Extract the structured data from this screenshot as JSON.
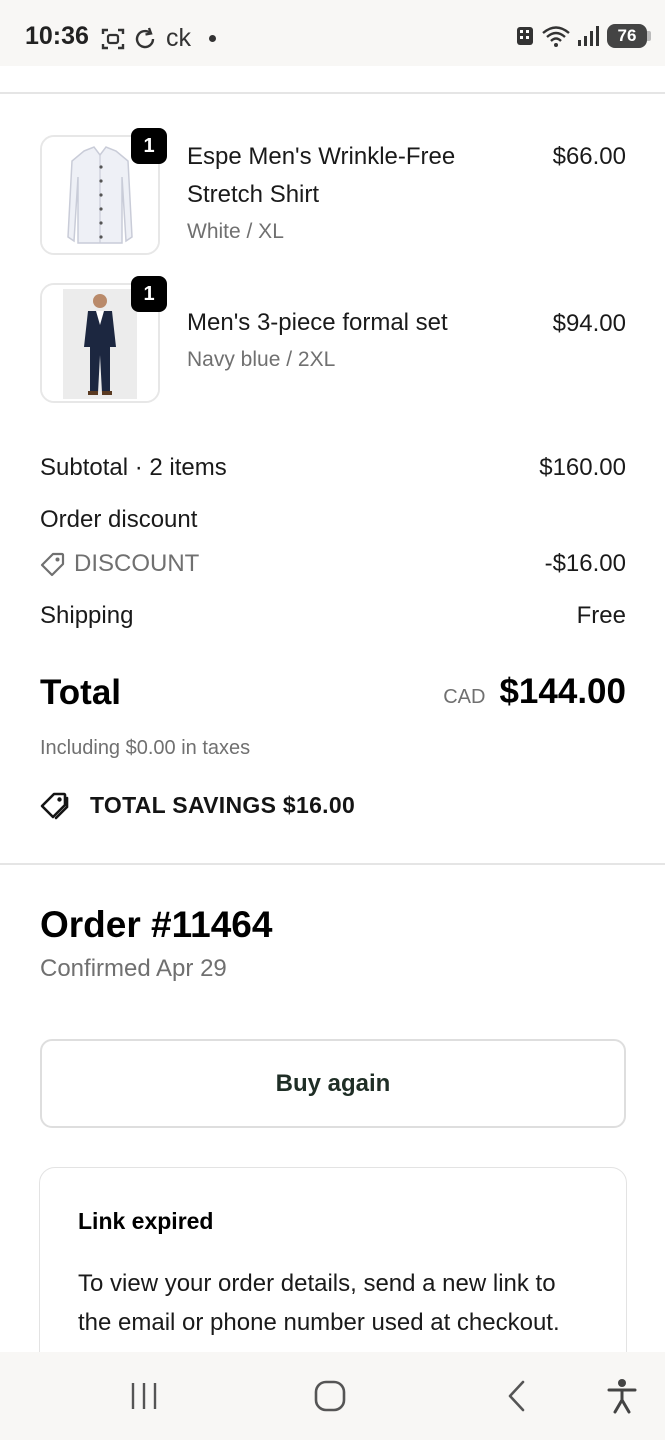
{
  "status_bar": {
    "time": "10:36",
    "app_text": "ck",
    "battery": "76",
    "icons": [
      "screenshot-icon",
      "sync-icon",
      "notification-dot",
      "building-icon",
      "wifi-icon",
      "signal-icon",
      "battery-icon"
    ]
  },
  "line_items": [
    {
      "quantity": "1",
      "name": "Espe Men's Wrinkle-Free Stretch Shirt",
      "variant": "White / XL",
      "price": "$66.00"
    },
    {
      "quantity": "1",
      "name": "Men's 3-piece formal set",
      "variant": "Navy blue / 2XL",
      "price": "$94.00"
    }
  ],
  "summary": {
    "subtotal_label": "Subtotal · 2 items",
    "subtotal_value": "$160.00",
    "order_discount_label": "Order discount",
    "discount_code": "DISCOUNT",
    "discount_value": "-$16.00",
    "shipping_label": "Shipping",
    "shipping_value": "Free",
    "total_label": "Total",
    "currency": "CAD",
    "total_value": "$144.00",
    "taxes_note": "Including $0.00 in taxes",
    "savings": "TOTAL SAVINGS $16.00"
  },
  "order": {
    "title": "Order #11464",
    "confirmed": "Confirmed Apr 29",
    "buy_again_label": "Buy again"
  },
  "link_card": {
    "title": "Link expired",
    "body": "To view your order details, send a new link to the email or phone number used at checkout."
  },
  "nav_bar": {
    "buttons": [
      "recent-apps-icon",
      "home-icon",
      "back-icon",
      "accessibility-icon"
    ]
  },
  "colors": {
    "accent_dark_green": "#1f2e26",
    "muted_text": "#707070",
    "divider": "#e5e5e5"
  }
}
